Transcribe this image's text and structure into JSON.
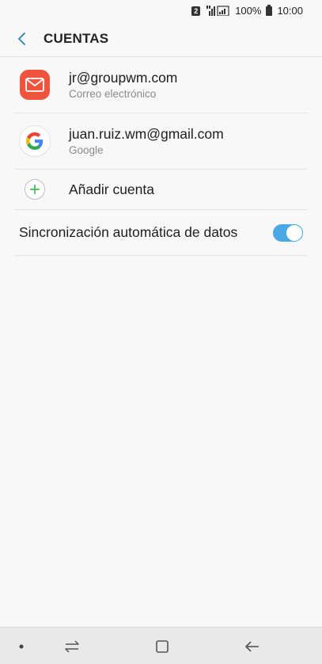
{
  "status_bar": {
    "sim_slot": "2",
    "battery": "100%",
    "time": "10:00"
  },
  "header": {
    "title": "CUENTAS",
    "accent_color": "#3f8fb7"
  },
  "accounts": [
    {
      "icon": "email-icon",
      "title": "jr@groupwm.com",
      "subtitle": "Correo electrónico",
      "icon_color": "#f0533e"
    },
    {
      "icon": "google-icon",
      "title": "juan.ruiz.wm@gmail.com",
      "subtitle": "Google"
    }
  ],
  "add_account": {
    "label": "Añadir cuenta",
    "icon": "plus-icon",
    "icon_color": "#3bb54a"
  },
  "sync": {
    "label": "Sincronización automática de datos",
    "enabled": true,
    "toggle_color": "#4aa8e4"
  },
  "nav_bar": {
    "icons": [
      "dot-icon",
      "recent-apps-icon",
      "home-icon",
      "back-icon"
    ]
  }
}
